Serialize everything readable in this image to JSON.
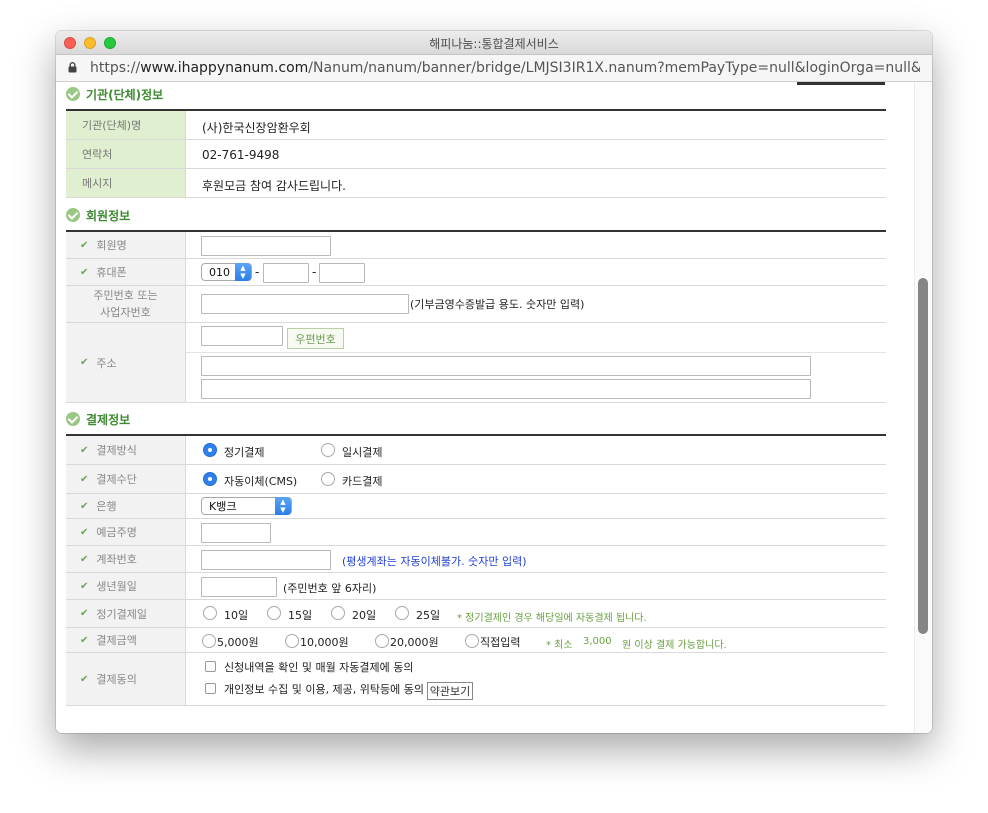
{
  "window": {
    "title": "해피나눔::통합결제서비스",
    "url_scheme": "https://",
    "url_host": "www.ihappynanum.com",
    "url_path": "/Nanum/nanum/banner/bridge/LMJSI3IR1X.nanum?memPayType=null&loginOrga=null&orga..."
  },
  "org_section": {
    "title": "기관(단체)정보",
    "rows": [
      {
        "label": "기관(단체)명",
        "value": "(사)한국신장암환우회"
      },
      {
        "label": "연락처",
        "value": "02-761-9498"
      },
      {
        "label": "메시지",
        "value": "후원모금 참여 감사드립니다."
      }
    ]
  },
  "member_section": {
    "title": "회원정보",
    "name_label": "회원명",
    "phone_label": "휴대폰",
    "phone_prefix": "010",
    "phone_dash": "-",
    "idnum_label_line1": "주민번호 또는",
    "idnum_label_line2": "사업자번호",
    "idnum_hint": "(기부금영수증발급 용도. 숫자만 입력)",
    "address_label": "주소",
    "zipcode_button": "우편번호"
  },
  "payment_section": {
    "title": "결제정보",
    "type_label": "결제방식",
    "type_options": [
      "정기결제",
      "일시결제"
    ],
    "method_label": "결제수단",
    "method_options": [
      "자동이체(CMS)",
      "카드결제"
    ],
    "bank_label": "은행",
    "bank_selected": "K뱅크",
    "holder_label": "예금주명",
    "account_label": "계좌번호",
    "account_hint": "(평생계좌는 자동이체불가. 숫자만 입력)",
    "birth_label": "생년월일",
    "birth_hint": "(주민번호 앞 6자리)",
    "day_label": "정기결제일",
    "day_options": [
      "10일",
      "15일",
      "20일",
      "25일"
    ],
    "day_note": "* 정기결제인 경우 해당일에 자동결제 됩니다.",
    "amount_label": "결제금액",
    "amount_options": [
      "5,000원",
      "10,000원",
      "20,000원",
      "직접입력"
    ],
    "amount_note_prefix": "* 최소",
    "amount_min": "3,000",
    "amount_note_suffix": "원 이상 결제 가능합니다.",
    "agree_label": "결제동의",
    "agree_1": "신청내역을 확인 및 매월 자동결제에 동의",
    "agree_2": "개인정보 수집 및 이용, 제공, 위탁등에 동의",
    "terms_button": "약관보기"
  },
  "colors": {
    "accent_green": "#3e8a32",
    "label_green_bg": "#e0efcf",
    "radio_blue": "#2f80ed",
    "hint_blue": "#1f3fd8"
  }
}
